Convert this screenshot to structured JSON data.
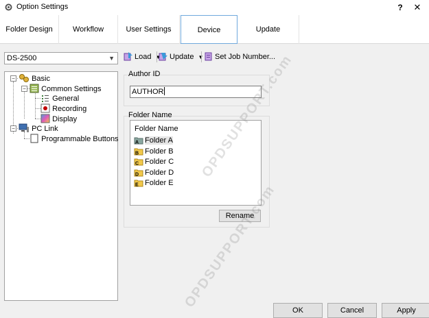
{
  "window": {
    "title": "Option Settings",
    "help_label": "?",
    "close_label": "✕"
  },
  "tabs": [
    {
      "label": "Folder Design"
    },
    {
      "label": "Workflow"
    },
    {
      "label": "User Settings"
    },
    {
      "label": "Device",
      "active": true
    },
    {
      "label": "Update"
    }
  ],
  "toolbar": {
    "model_selected": "DS-2500",
    "load_label": "Load",
    "update_label": "Update",
    "set_job_label": "Set Job Number..."
  },
  "tree": {
    "basic": "Basic",
    "common_settings": "Common Settings",
    "general": "General",
    "recording": "Recording",
    "display": "Display",
    "pc_link": "PC Link",
    "programmable_buttons": "Programmable Buttons"
  },
  "author": {
    "group_label": "Author ID",
    "value": "AUTHOR"
  },
  "folders": {
    "group_label": "Folder Name",
    "header": "Folder Name",
    "items": [
      {
        "letter": "A",
        "label": "Folder A"
      },
      {
        "letter": "B",
        "label": "Folder B"
      },
      {
        "letter": "C",
        "label": "Folder C"
      },
      {
        "letter": "D",
        "label": "Folder D"
      },
      {
        "letter": "E",
        "label": "Folder E"
      }
    ],
    "rename_label": "Rename"
  },
  "footer": {
    "ok_label": "OK",
    "cancel_label": "Cancel",
    "apply_label": "Apply"
  },
  "watermark": "OPDSUPPORT.com",
  "colors": {
    "active_tab_border": "#6fa8dc",
    "folder_yellow": "#f2c94c",
    "recording_red": "#c00000"
  }
}
